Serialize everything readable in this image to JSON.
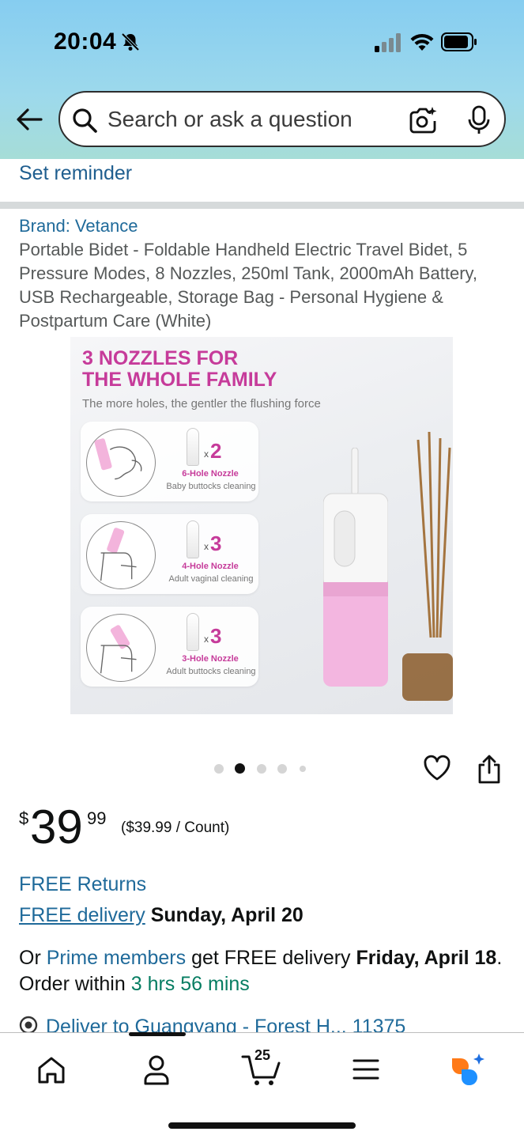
{
  "status_bar": {
    "time": "20:04",
    "icons": [
      "bell-slash-icon",
      "signal-icon",
      "wifi-icon",
      "battery-icon"
    ]
  },
  "search": {
    "placeholder": "Search or ask a question",
    "icons": [
      "back-arrow-icon",
      "search-icon",
      "camera-icon",
      "mic-icon"
    ]
  },
  "reminder": {
    "label": "Set reminder"
  },
  "product": {
    "brand": "Brand: Vetance",
    "title": "Portable Bidet - Foldable Handheld Electric Travel Bidet, 5 Pressure Modes, 8 Nozzles, 250ml Tank, 2000mAh Battery, USB Rechargeable, Storage Bag - Personal Hygiene & Postpartum Care (White)",
    "image": {
      "headline_line1": "3 NOZZLES FOR",
      "headline_line2": "THE WHOLE FAMILY",
      "subline": "The more holes, the gentler the flushing force",
      "cards": [
        {
          "mult": "x",
          "qty": "2",
          "name": "6-Hole Nozzle",
          "desc": "Baby buttocks cleaning"
        },
        {
          "mult": "x",
          "qty": "3",
          "name": "4-Hole Nozzle",
          "desc": "Adult vaginal cleaning"
        },
        {
          "mult": "x",
          "qty": "3",
          "name": "3-Hole Nozzle",
          "desc": "Adult buttocks cleaning"
        }
      ]
    },
    "carousel": {
      "count": 5,
      "active_index": 1
    }
  },
  "price": {
    "symbol": "$",
    "whole": "39",
    "fraction": "99",
    "unit_price": "($39.99 / Count)"
  },
  "shipping": {
    "free_returns": "FREE Returns",
    "free_delivery_link": "FREE delivery",
    "delivery_date": "Sunday, April 20",
    "prime_prefix": "Or ",
    "prime_link": "Prime members",
    "prime_mid": " get FREE delivery ",
    "prime_date": "Friday, April 18",
    "prime_order": ". Order within ",
    "countdown": "3 hrs 56 mins",
    "deliver_to": "Deliver to Guangyang - Forest H... 11375"
  },
  "bottom_nav": {
    "items": [
      "home-icon",
      "account-icon",
      "cart-icon",
      "menu-icon",
      "rufus-icon"
    ],
    "cart_count": "25"
  },
  "colors": {
    "link": "#1f6a9a",
    "accent_pink": "#c63b9a",
    "countdown_green": "#067d62",
    "header_gradient_top": "#86cdf0",
    "header_gradient_bottom": "#a6ddd7"
  }
}
